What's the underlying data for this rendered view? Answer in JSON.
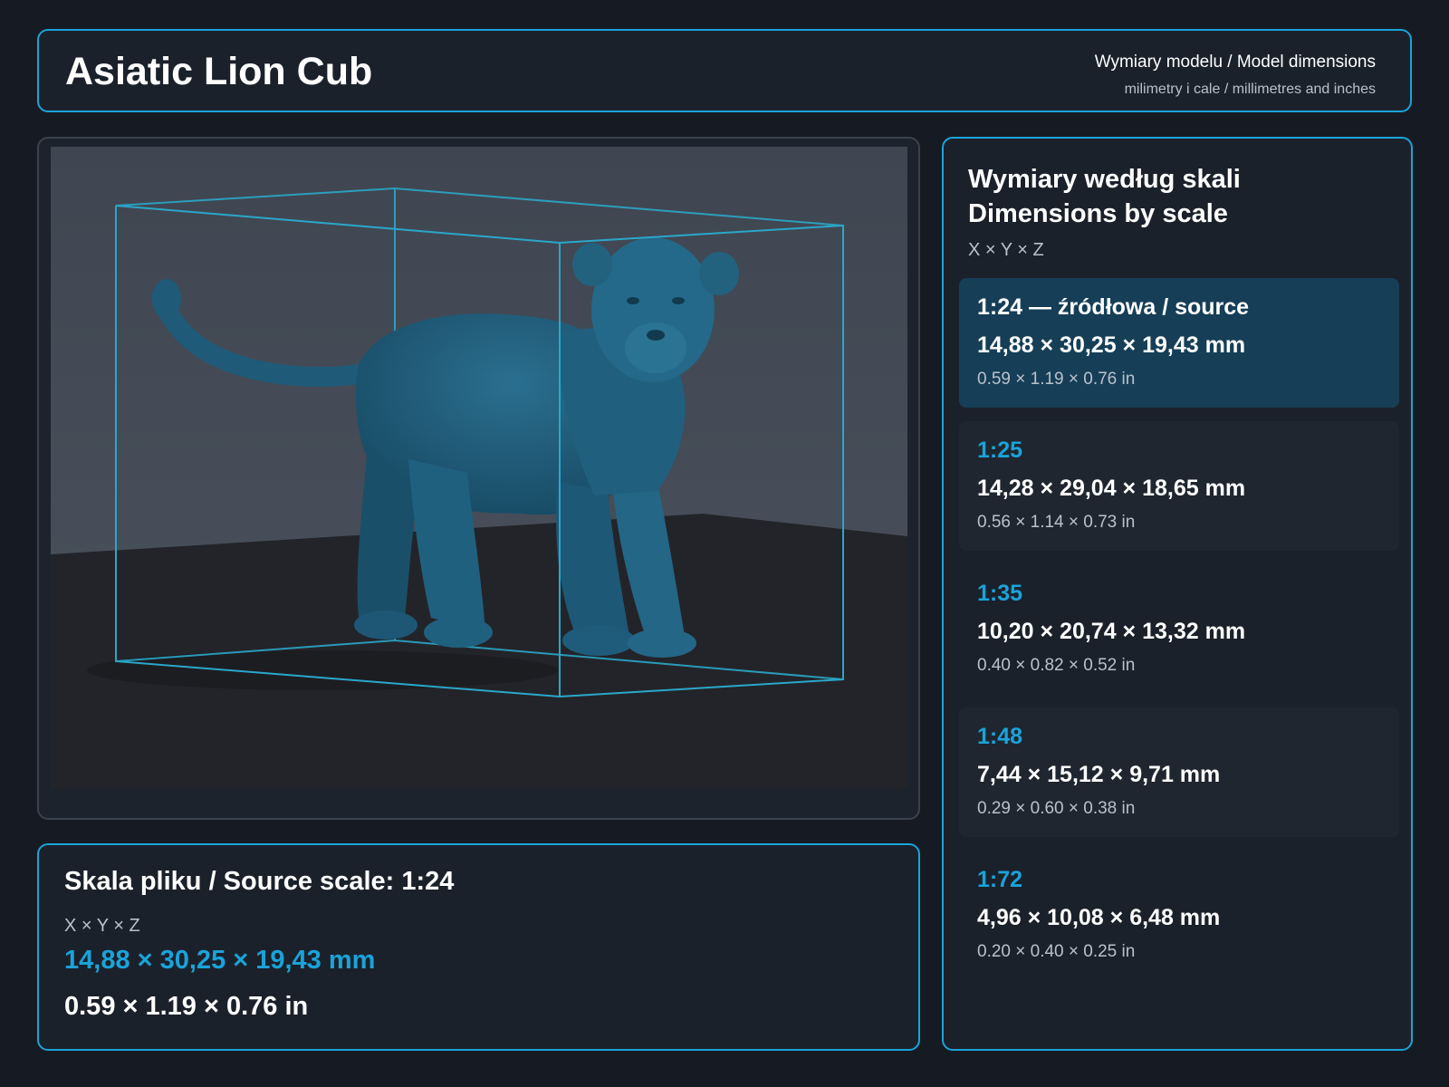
{
  "header": {
    "title": "Asiatic Lion Cub",
    "subtitle": "Wymiary modelu / Model dimensions",
    "units_note": "milimetry i cale / millimetres and inches"
  },
  "viewer": {
    "model_color": "#1f5a78",
    "bbox_color": "#2aa7c9",
    "backdrop_color": "#474e59",
    "floor_color": "#232429"
  },
  "source": {
    "title": "Skala pliku / Source scale: 1:24",
    "axes": "X × Y × Z",
    "mm": "14,88 × 30,25 × 19,43 mm",
    "inches": "0.59 × 1.19 × 0.76 in"
  },
  "scales_panel": {
    "title_pl": "Wymiary według skali",
    "title_en": "Dimensions by scale",
    "axes": "X × Y × Z",
    "rows": [
      {
        "scale": "1:24  —  źródłowa / source",
        "mm": "14,88 × 30,25 × 19,43 mm",
        "inches": "0.59 × 1.19 × 0.76 in",
        "selected": true
      },
      {
        "scale": "1:25",
        "mm": "14,28 × 29,04 × 18,65 mm",
        "inches": "0.56 × 1.14 × 0.73 in"
      },
      {
        "scale": "1:35",
        "mm": "10,20 × 20,74 × 13,32 mm",
        "inches": "0.40 × 0.82 × 0.52 in"
      },
      {
        "scale": "1:48",
        "mm": "7,44 × 15,12 × 9,71 mm",
        "inches": "0.29 × 0.60 × 0.38 in"
      },
      {
        "scale": "1:72",
        "mm": "4,96 × 10,08 × 6,48 mm",
        "inches": "0.20 × 0.40 × 0.25 in"
      }
    ]
  },
  "colors": {
    "accent": "#1aa3d9",
    "background": "#161b23",
    "panel": "#1b212b",
    "selected_row": "#163f57"
  }
}
